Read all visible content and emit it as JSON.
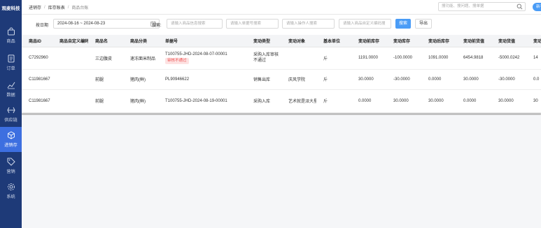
{
  "app": {
    "logo": "观麦科技"
  },
  "sidebar": {
    "items": [
      {
        "label": "商品",
        "icon": "bag-icon"
      },
      {
        "label": "订单",
        "icon": "order-icon"
      },
      {
        "label": "数据",
        "icon": "chart-icon"
      },
      {
        "label": "供应链",
        "icon": "exchange-icon"
      },
      {
        "label": "进销存",
        "icon": "cube-icon",
        "active": true
      },
      {
        "label": "营销",
        "icon": "tag-icon"
      },
      {
        "label": "系统",
        "icon": "gear-icon"
      }
    ]
  },
  "topbar": {
    "breadcrumb": [
      "进销存",
      "库存账表",
      "商品台账"
    ],
    "search_placeholder": "搜功能、搜问题、搜单据",
    "new_button": "新手引导"
  },
  "filter": {
    "date_label": "按日期",
    "date_value": "2024-08-16 ~ 2024-08-23",
    "search_label": "搜索:",
    "inputs": [
      "请输入商品信息搜索",
      "请输入单据号搜索",
      "请输入操作人搜索",
      "请输入商品自定义编码搜"
    ],
    "search_button": "搜索",
    "export_button": "导出"
  },
  "table": {
    "columns": [
      "商品ID",
      "商品自定义编码",
      "商品名",
      "商品分类",
      "单据号",
      "变动类型",
      "变动对象",
      "基本单位",
      "变动前库存",
      "变动库存",
      "变动后库存",
      "变动前货值",
      "变动货值",
      "变动"
    ],
    "rows": [
      {
        "id": "C7292960",
        "code": "",
        "name": "三边腹皮",
        "category": "速冻面米制品",
        "doc": "T100755-JHD-2024-08-07-00001",
        "badge": "审核不通过",
        "type": "采购入库审核不通过",
        "target": "",
        "unit": "斤",
        "before": "1191.0000",
        "change": "-100.0000",
        "after": "1091.0000",
        "val_before": "6454.9818",
        "val_change": "-5000.0242",
        "extra": "14"
      },
      {
        "id": "C11981667",
        "code": "",
        "name": "前腿",
        "category": "猪肉(鲜)",
        "doc": "PL90946622",
        "badge": "",
        "type": "销售出库",
        "target": "庆风学院",
        "unit": "斤",
        "before": "30.0000",
        "change": "-30.0000",
        "after": "0.0000",
        "val_before": "30.0000",
        "val_change": "-30.0000",
        "extra": "0.0"
      },
      {
        "id": "C11981667",
        "code": "",
        "name": "前腿",
        "category": "猪肉(鲜)",
        "doc": "T100755-JHD-2024-08-19-00001",
        "badge": "",
        "type": "采购入库",
        "target": "艺术就是派大星",
        "unit": "斤",
        "before": "0.0000",
        "change": "30.0000",
        "after": "30.0000",
        "val_before": "0.0000",
        "val_change": "30.0000",
        "extra": "30"
      }
    ]
  },
  "colors": {
    "sidebar": "#1e3a78",
    "active": "#3d6fe0",
    "primary": "#4a9cf6",
    "badge_bg": "#fde2e2",
    "badge_text": "#e55555"
  }
}
